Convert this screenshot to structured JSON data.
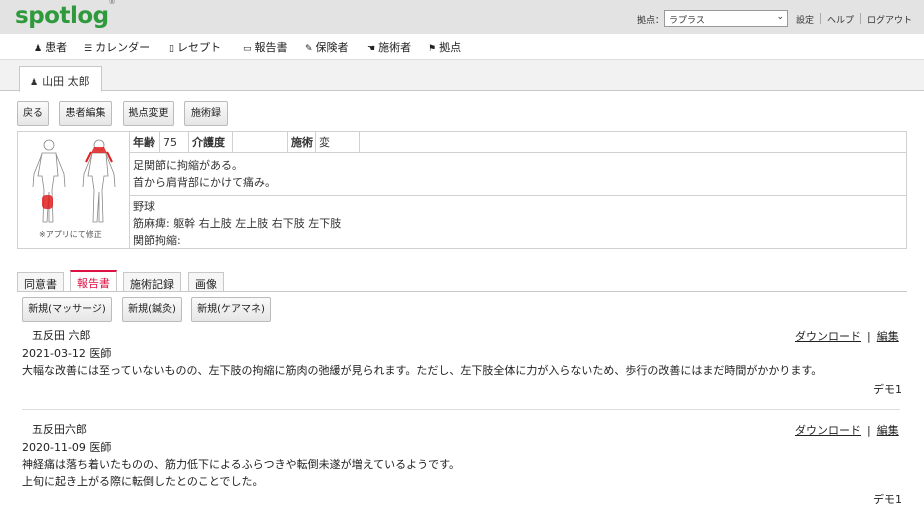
{
  "header": {
    "logo": "spotlog",
    "logo_mark": "®",
    "base_label": "拠点：",
    "base_selected": "ラプラス",
    "links": [
      "設定",
      "ヘルプ",
      "ログアウト"
    ]
  },
  "nav": {
    "items": [
      {
        "label": "患者",
        "icon": "person-icon"
      },
      {
        "label": "カレンダー",
        "icon": "list-icon"
      },
      {
        "label": "レセプト",
        "icon": "clipboard-icon"
      },
      {
        "label": "報告書",
        "icon": "document-icon"
      },
      {
        "label": "保険者",
        "icon": "wrench-icon"
      },
      {
        "label": "施術者",
        "icon": "hand-icon"
      },
      {
        "label": "拠点",
        "icon": "flag-icon"
      }
    ]
  },
  "patient_tab": {
    "name": "山田 太郎",
    "icon": "person-icon"
  },
  "buttons": {
    "back": "戻る",
    "edit_patient": "患者編集",
    "change_base": "拠点変更",
    "treatment_record": "施術録"
  },
  "info": {
    "age_label": "年齢",
    "age_value": "75",
    "care_label": "介護度",
    "care_value": "",
    "treatment_label": "施術",
    "treatment_value": "変",
    "note_lines": [
      "足関節に拘縮がある。",
      "首から肩背部にかけて痛み。"
    ],
    "detail_lines": [
      "野球",
      "筋麻痺: 躯幹 右上肢 左上肢 右下肢 左下肢",
      "関節拘縮:"
    ],
    "figure_caption": "※アプリにて修正"
  },
  "section_tabs": [
    "同意書",
    "報告書",
    "施術記録",
    "画像"
  ],
  "new_buttons": [
    "新規(マッサージ)",
    "新規(鍼灸)",
    "新規(ケアマネ)"
  ],
  "reports": [
    {
      "recipient": "五反田 六郎",
      "date_line": "2021-03-12 医師",
      "body": [
        "大幅な改善には至っていないものの、左下肢の拘縮に筋肉の弛緩が見られます。ただし、左下肢全体に力が入らないため、歩行の改善にはまだ時間がかかります。"
      ],
      "author": "デモ1"
    },
    {
      "recipient": "五反田六郎",
      "date_line": "2020-11-09 医師",
      "body": [
        "神経痛は落ち着いたものの、筋力低下によるふらつきや転倒未遂が増えているようです。",
        "上旬に起き上がる際に転倒したとのことでした。"
      ],
      "author": "デモ1"
    }
  ],
  "report_actions": {
    "download": "ダウンロード",
    "separator": "|",
    "edit": "編集"
  },
  "colors": {
    "brand": "#2e9a3c",
    "active_tab": "#dd1144",
    "pain_mark": "#e02020"
  }
}
